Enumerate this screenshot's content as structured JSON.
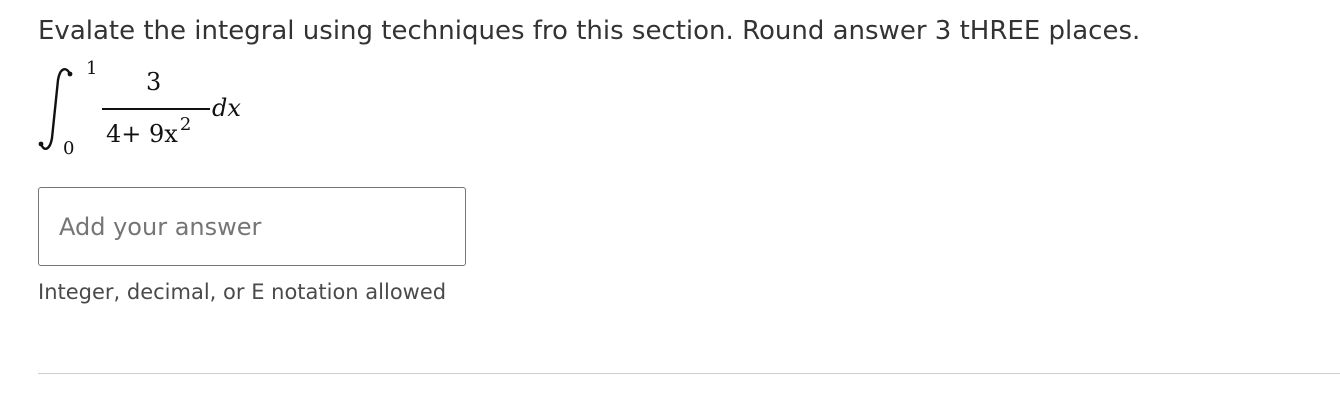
{
  "question": {
    "text": "Evalate the integral using techniques fro this section. Round answer 3 tHREE places."
  },
  "math": {
    "upper_limit": "1",
    "lower_limit": "0",
    "numerator": "3",
    "denominator_base": "4+ 9x",
    "denominator_exponent": "2",
    "differential": "dx"
  },
  "answer": {
    "value": "",
    "placeholder": "Add your answer"
  },
  "hint": {
    "text": "Integer, decimal, or E notation allowed"
  }
}
